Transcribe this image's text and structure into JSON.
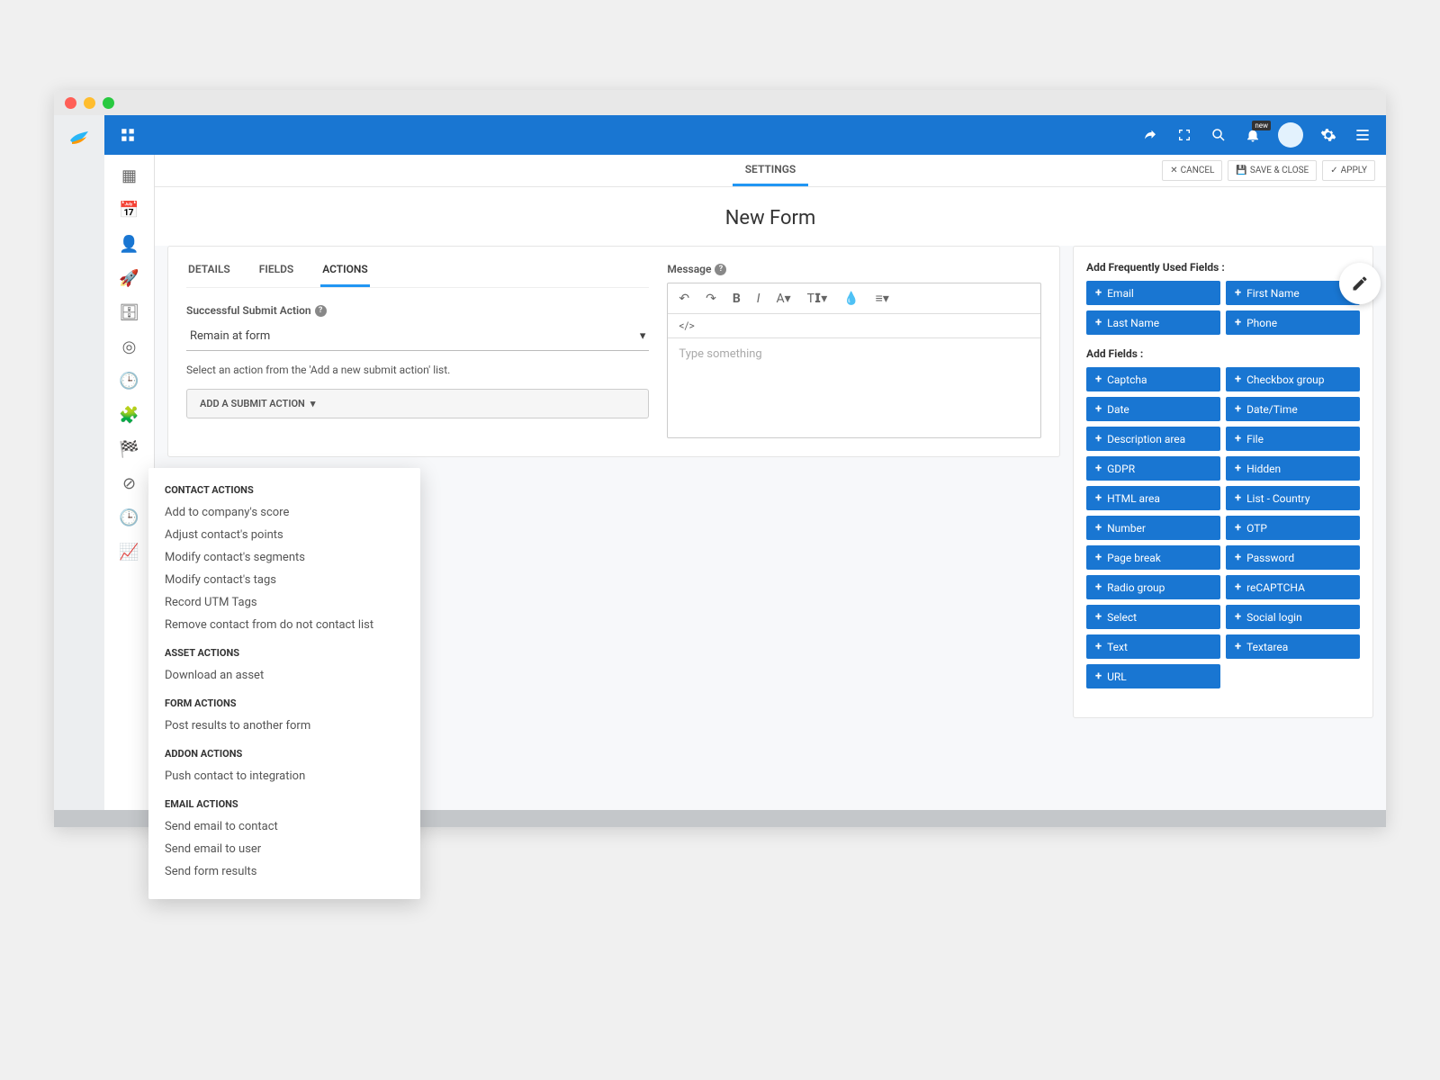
{
  "window": {
    "title_tab": "SETTINGS"
  },
  "pageActions": {
    "cancel": "CANCEL",
    "save": "SAVE & CLOSE",
    "apply": "APPLY"
  },
  "pageTitle": "New Form",
  "innerTabs": {
    "details": "DETAILS",
    "fields": "FIELDS",
    "actions": "ACTIONS"
  },
  "submitAction": {
    "label": "Successful Submit Action",
    "value": "Remain at form",
    "hint": "Select an action from the 'Add a new submit action' list.",
    "addButton": "ADD A SUBMIT ACTION"
  },
  "message": {
    "label": "Message",
    "placeholder": "Type something"
  },
  "freqHeading": "Add Frequently Used Fields :",
  "freqFields": [
    "Email",
    "First Name",
    "Last Name",
    "Phone"
  ],
  "fieldsHeading": "Add Fields :",
  "fields": [
    "Captcha",
    "Checkbox group",
    "Date",
    "Date/Time",
    "Description area",
    "File",
    "GDPR",
    "Hidden",
    "HTML area",
    "List - Country",
    "Number",
    "OTP",
    "Page break",
    "Password",
    "Radio group",
    "reCAPTCHA",
    "Select",
    "Social login",
    "Text",
    "Textarea",
    "URL"
  ],
  "notificationBadge": "new",
  "dropdown": {
    "groups": [
      {
        "title": "CONTACT ACTIONS",
        "items": [
          "Add to company's score",
          "Adjust contact's points",
          "Modify contact's segments",
          "Modify contact's tags",
          "Record UTM Tags",
          "Remove contact from do not contact list"
        ]
      },
      {
        "title": "ASSET ACTIONS",
        "items": [
          "Download an asset"
        ]
      },
      {
        "title": "FORM ACTIONS",
        "items": [
          "Post results to another form"
        ]
      },
      {
        "title": "ADDON ACTIONS",
        "items": [
          "Push contact to integration"
        ]
      },
      {
        "title": "EMAIL ACTIONS",
        "items": [
          "Send email to contact",
          "Send email to user",
          "Send form results"
        ]
      }
    ]
  }
}
